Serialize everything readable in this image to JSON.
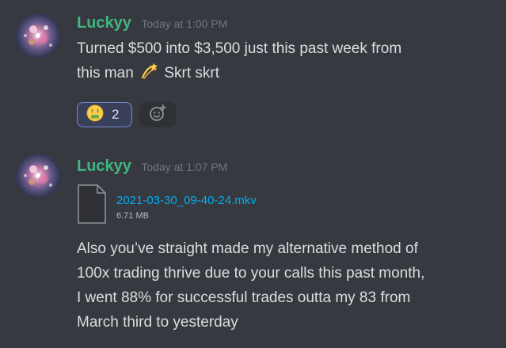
{
  "messages": [
    {
      "username": "Luckyy",
      "timestamp": "Today at 1:00 PM",
      "text_line1": "Turned $500 into $3,500 just this past week from",
      "text_line2_before": "this man",
      "text_line2_after": "Skrt skrt",
      "inline_emoji": "dizzy-icon",
      "reaction": {
        "emoji": "money-mouth-face-icon",
        "count": "2"
      },
      "add_reaction_icon": "add-reaction-icon"
    },
    {
      "username": "Luckyy",
      "timestamp": "Today at 1:07 PM",
      "attachment": {
        "icon": "file-icon",
        "name": "2021-03-30_09-40-24.mkv",
        "size": "6.71 MB"
      },
      "text_lines": [
        "Also you’ve straight made my alternative method of",
        "100x trading thrive due to your calls this past month,",
        "I went 88% for successful trades outta my 83 from",
        "March third to yesterday"
      ]
    }
  ],
  "colors": {
    "background": "#36393f",
    "username": "#43b581",
    "timestamp": "#72767d",
    "text": "#dcddde",
    "link": "#00aff4",
    "reaction_border": "#7289da",
    "reaction_bg": "#3b405a"
  }
}
